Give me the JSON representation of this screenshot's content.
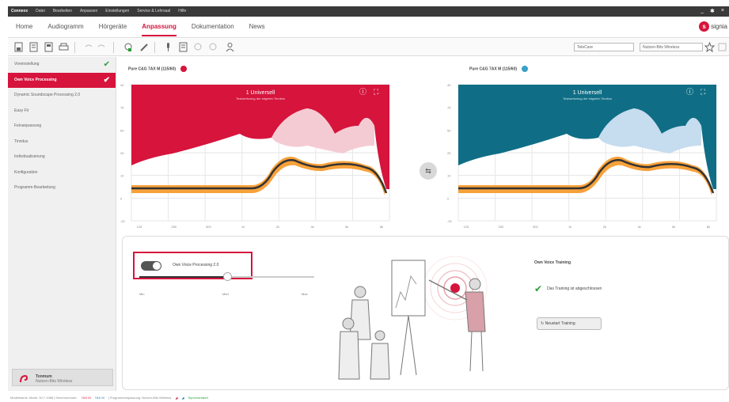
{
  "titlebar": {
    "menu": [
      "Connexx",
      "Datei",
      "Bearbeiten",
      "Anpassen",
      "Einstellungen",
      "Service & Lehrsaal",
      "Hilfe"
    ],
    "controls": [
      "_",
      "✱",
      "×"
    ]
  },
  "nav": {
    "tabs": [
      {
        "label": "Home",
        "active": false
      },
      {
        "label": "Audiogramm",
        "active": false
      },
      {
        "label": "Hörgeräte",
        "active": false
      },
      {
        "label": "Anpassung",
        "active": true
      },
      {
        "label": "Dokumentation",
        "active": false
      },
      {
        "label": "News",
        "active": false
      }
    ],
    "brand": "signia",
    "brand_logo_letter": "s"
  },
  "toolbar": {
    "icons": [
      "save-icon",
      "open-icon",
      "import-icon",
      "print-icon",
      "undo-icon",
      "redo-icon",
      "fitting-icon",
      "wrench-icon",
      "mic-icon",
      "report-icon",
      "arrow-left-icon",
      "arrow-right-icon",
      "person-icon"
    ],
    "select1": "TeleCare",
    "select2": "Nutzen-Bits Wireless"
  },
  "sidebar": {
    "items": [
      {
        "label": "Voreinstellung",
        "checked": true,
        "active": false
      },
      {
        "label": "Own Voice Processing",
        "checked": true,
        "active": true
      },
      {
        "label": "Dynamic Soundscape Processing 2.0",
        "checked": false,
        "active": false
      },
      {
        "label": "Easy Fit",
        "checked": false,
        "active": false
      },
      {
        "label": "Feinanpassung",
        "checked": false,
        "active": false
      },
      {
        "label": "Tinnitus",
        "checked": false,
        "active": false
      },
      {
        "label": "Individualisierung",
        "checked": false,
        "active": false
      },
      {
        "label": "Konfiguration",
        "checked": false,
        "active": false
      },
      {
        "label": "Programm-Bearbeitung",
        "checked": false,
        "active": false
      }
    ],
    "device": {
      "line1": "Tonmum",
      "line2": "Nutzen-Bits Wireless"
    },
    "check_glyph": "✔"
  },
  "left_chart": {
    "title": "Pure C&G 7AX M (115/60)",
    "color": "#d6143c",
    "program": "1 Universell",
    "program_sub": "Testwerkzeug der stigeriet-Tinnitus",
    "y_ticks": [
      "40",
      "75",
      "50",
      "25",
      "10",
      "0",
      "-20"
    ],
    "x_ticks": [
      "125",
      "250",
      "500",
      "1k",
      "2k",
      "4k",
      "6k",
      "8k"
    ],
    "info_glyph": "ⓘ",
    "expand_glyph": "⛶"
  },
  "right_chart": {
    "title": "Pure C&G 7AX M (115/60)",
    "color": "#0f6e86",
    "program": "1 Universell",
    "program_sub": "Testwerkzeug der stigeriet-Tinnitus",
    "y_ticks": [
      "40",
      "75",
      "50",
      "25",
      "10",
      "0",
      "-20"
    ],
    "x_ticks": [
      "125",
      "250",
      "500",
      "1k",
      "2k",
      "4k",
      "6k",
      "8k"
    ],
    "info_glyph": "ⓘ",
    "expand_glyph": "⛶"
  },
  "swap_icon": "⇆",
  "ovp": {
    "toggle_label": "Own Voice Processing 2.0",
    "toggle_on": true,
    "slider_labels": [
      "Min",
      "Med",
      "Max"
    ],
    "slider_value": 0.5
  },
  "training": {
    "title": "Own Voice Training",
    "done_glyph": "✔",
    "done_text": "Das Training ist abgeschlossen",
    "restart_glyph": "↻",
    "restart_label": "Neustart Training"
  },
  "statusbar": {
    "text": "Modellname: Marie: 30.7.1988 | Seriennummer:",
    "left": "7AX M",
    "right": "7AX M",
    "program": "| Programmanpassung: Nutzen-Bits Wireless",
    "connected": "Synchronisiert"
  }
}
